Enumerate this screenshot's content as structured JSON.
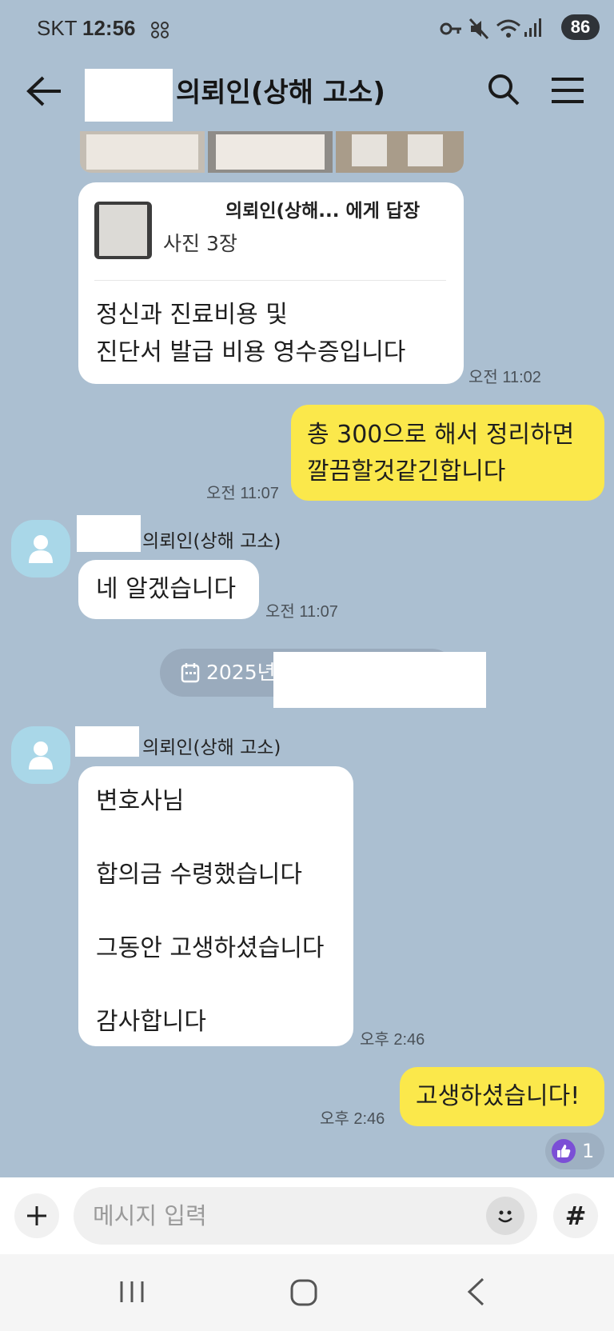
{
  "status_bar": {
    "carrier": "SKT",
    "time": "12:56",
    "battery": "86"
  },
  "header": {
    "title": "의뢰인(상해 고소)"
  },
  "reply_card": {
    "reply_to": "의뢰인(상해... 에게 답장",
    "attachment": "사진 3장",
    "text_line1": "정신과 진료비용 및",
    "text_line2": "진단서 발급 비용 영수증입니다",
    "time": "오전 11:02"
  },
  "msg_out_1": {
    "line1": "총 300으로 해서 정리하면",
    "line2": "깔끔할것같긴합니다",
    "time": "오전 11:07"
  },
  "sender_name": "의뢰인(상해 고소)",
  "msg_in_1": {
    "text": "네 알겠습니다",
    "time": "오전 11:07"
  },
  "date_divider": {
    "text": "2025년"
  },
  "msg_in_2": {
    "line1": "변호사님",
    "line2": "합의금 수령했습니다",
    "line3": "그동안 고생하셨습니다",
    "line4": "감사합니다",
    "time": "오후 2:46"
  },
  "msg_out_2": {
    "text": "고생하셨습니다!",
    "time": "오후 2:46",
    "reaction_count": "1"
  },
  "input": {
    "placeholder": "메시지 입력",
    "hash_label": "#"
  },
  "colors": {
    "background": "#abbfd1",
    "mine": "#fbe84b",
    "theirs": "#ffffff",
    "reaction": "#7b4fd6"
  }
}
